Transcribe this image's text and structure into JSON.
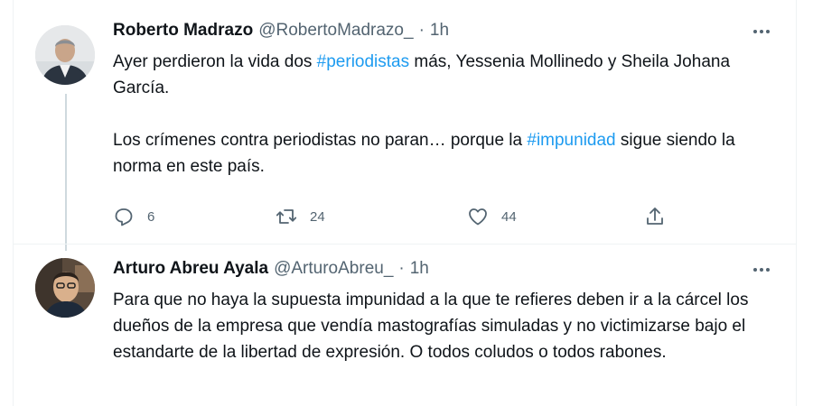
{
  "tweets": [
    {
      "author_name": "Roberto Madrazo",
      "handle": "@RobertoMadrazo_",
      "separator": "·",
      "time": "1h",
      "paragraph1_before": "Ayer perdieron la vida dos ",
      "paragraph1_hashtag": "#periodistas",
      "paragraph1_after": " más, Yessenia Mollinedo y Sheila Johana García.",
      "paragraph2_before": "Los crímenes contra periodistas no paran… porque la ",
      "paragraph2_hashtag": "#impunidad",
      "paragraph2_after": " sigue siendo la norma en este país.",
      "replies": "6",
      "retweets": "24",
      "likes": "44"
    },
    {
      "author_name": "Arturo Abreu Ayala",
      "handle": "@ArturoAbreu_",
      "separator": "·",
      "time": "1h",
      "text": "Para que no haya la supuesta impunidad a la que te refieres deben ir a la cárcel los dueños de la empresa que vendía mastografías simuladas y no victimizarse bajo el estandarte de la libertad de expresión. O todos coludos o todos rabones."
    }
  ],
  "icons": {
    "reply": "reply-icon",
    "retweet": "retweet-icon",
    "like": "heart-icon",
    "share": "share-icon",
    "more": "more-options-icon"
  },
  "colors": {
    "hashtag": "#1d9bf0",
    "secondary_text": "#536471",
    "primary_text": "#0f1419"
  }
}
